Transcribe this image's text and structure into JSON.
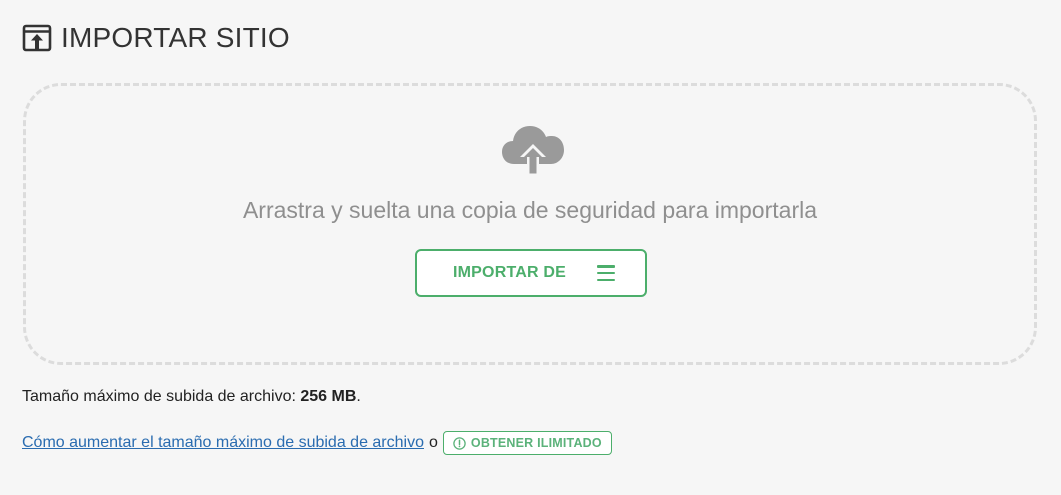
{
  "header": {
    "title": "IMPORTAR SITIO",
    "icon": "import-upload-icon"
  },
  "dropzone": {
    "icon": "cloud-upload-icon",
    "text": "Arrastra y suelta una copia de seguridad para importarla",
    "button_label": "IMPORTAR DE",
    "button_icon": "menu-icon"
  },
  "footer": {
    "max_size_label": "Tamaño máximo de subida de archivo:",
    "max_size_value": "256 MB",
    "max_size_suffix": ".",
    "help_link": "Cómo aumentar el tamaño máximo de subida de archivo",
    "or": "o",
    "unlimited_label": "OBTENER ILIMITADO",
    "unlimited_icon": "exclamation-circle-icon"
  },
  "colors": {
    "accent_green": "#4cae6b",
    "link_blue": "#2a6cb0",
    "muted_text": "#8f8f8f",
    "dashed_border": "#dcdcdc",
    "background": "#f6f6f6"
  }
}
